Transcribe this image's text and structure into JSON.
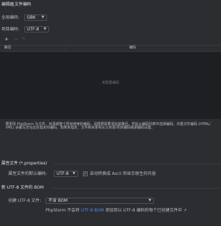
{
  "tabs": [
    "编辑器",
    "文件编码"
  ],
  "global_encoding": {
    "label": "全局编码:",
    "value": "GBK"
  },
  "project_encoding": {
    "label": "项目编码:",
    "value": "UTF-8"
  },
  "toolbar": {
    "add": "+",
    "remove": "−",
    "edit": "✎"
  },
  "table": {
    "columns": [
      "路径",
      "编码"
    ],
    "empty_text": "未配置编码"
  },
  "description": [
    "要更改 PhpStorm 为文件、目录或整个项目使用的编码，请根据需要添加其路径。然后从编码列表中选择编码。内置文件编码 (HTML/",
    "XML) 会覆写您在此处指定的编码。如果未指定，文件和目录将从父目录/项目编码继承编码设置。"
  ],
  "properties_section": {
    "title": "属性文件 (*.properties)",
    "default_label": "属性文件的默认编码:",
    "default_value": "UTF-8",
    "transparent_checked": true,
    "transparent_label": "自动转换成 Ascii 但显示原生的内容"
  },
  "bom_section": {
    "title": "新 UTF-8 文件的 BOM",
    "create_label": "创建 UTF-8 文件:",
    "create_value": "不含 BOM",
    "note_prefix": "PhpStorm 不会将",
    "note_link": "UTF-8 BOM",
    "note_suffix": "添加到以 UTF-8 编码的每个已创建文件中 ↗"
  },
  "icons": {
    "dropdown": "chevron-down-icon",
    "check": "checkmark-icon"
  }
}
